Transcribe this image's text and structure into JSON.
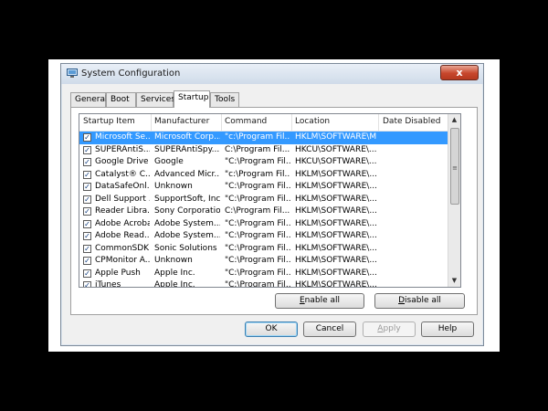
{
  "window": {
    "title": "System Configuration",
    "close_symbol": "x",
    "icon": "system-config-icon"
  },
  "tabs": [
    {
      "label": "General",
      "active": false
    },
    {
      "label": "Boot",
      "active": false
    },
    {
      "label": "Services",
      "active": false
    },
    {
      "label": "Startup",
      "active": true
    },
    {
      "label": "Tools",
      "active": false
    }
  ],
  "columns": [
    "Startup Item",
    "Manufacturer",
    "Command",
    "Location",
    "Date Disabled"
  ],
  "rows": [
    {
      "item": "Microsoft Se...",
      "manufacturer": "Microsoft Corp...",
      "command": "\"c:\\Program Fil...",
      "location": "HKLM\\SOFTWARE\\M...",
      "date": "",
      "checked": true,
      "selected": true
    },
    {
      "item": "SUPERAntiS...",
      "manufacturer": "SUPERAntiSpy...",
      "command": "C:\\Program Fil...",
      "location": "HKCU\\SOFTWARE\\...",
      "date": "",
      "checked": true,
      "selected": false
    },
    {
      "item": "Google Drive",
      "manufacturer": "Google",
      "command": "\"C:\\Program Fil...",
      "location": "HKCU\\SOFTWARE\\...",
      "date": "",
      "checked": true,
      "selected": false
    },
    {
      "item": "Catalyst® C...",
      "manufacturer": "Advanced Micr...",
      "command": "\"c:\\Program Fil...",
      "location": "HKLM\\SOFTWARE\\...",
      "date": "",
      "checked": true,
      "selected": false
    },
    {
      "item": "DataSafeOnl...",
      "manufacturer": "Unknown",
      "command": "\"C:\\Program Fil...",
      "location": "HKLM\\SOFTWARE\\...",
      "date": "",
      "checked": true,
      "selected": false
    },
    {
      "item": "Dell Support ...",
      "manufacturer": "SupportSoft, Inc.",
      "command": "\"C:\\Program Fil...",
      "location": "HKLM\\SOFTWARE\\...",
      "date": "",
      "checked": true,
      "selected": false
    },
    {
      "item": "Reader Libra...",
      "manufacturer": "Sony Corporation",
      "command": "C:\\Program Fil...",
      "location": "HKLM\\SOFTWARE\\...",
      "date": "",
      "checked": true,
      "selected": false
    },
    {
      "item": "Adobe Acrobat",
      "manufacturer": "Adobe System...",
      "command": "\"C:\\Program Fil...",
      "location": "HKLM\\SOFTWARE\\...",
      "date": "",
      "checked": true,
      "selected": false
    },
    {
      "item": "Adobe Read...",
      "manufacturer": "Adobe System...",
      "command": "\"C:\\Program Fil...",
      "location": "HKLM\\SOFTWARE\\...",
      "date": "",
      "checked": true,
      "selected": false
    },
    {
      "item": "CommonSDK",
      "manufacturer": "Sonic Solutions",
      "command": "\"C:\\Program Fil...",
      "location": "HKLM\\SOFTWARE\\...",
      "date": "",
      "checked": true,
      "selected": false
    },
    {
      "item": "CPMonitor A...",
      "manufacturer": "Unknown",
      "command": "\"C:\\Program Fil...",
      "location": "HKLM\\SOFTWARE\\...",
      "date": "",
      "checked": true,
      "selected": false
    },
    {
      "item": "Apple Push",
      "manufacturer": "Apple Inc.",
      "command": "\"C:\\Program Fil...",
      "location": "HKLM\\SOFTWARE\\...",
      "date": "",
      "checked": true,
      "selected": false
    },
    {
      "item": "iTunes",
      "manufacturer": "Apple Inc.",
      "command": "\"C:\\Program Fil...",
      "location": "HKLM\\SOFTWARE\\...",
      "date": "",
      "checked": true,
      "selected": false
    }
  ],
  "check_symbol": "✓",
  "scroll": {
    "up": "▲",
    "down": "▼",
    "grip": "≡"
  },
  "buttons": {
    "enable_all": {
      "access": "E",
      "rest": "nable all"
    },
    "disable_all": {
      "access": "D",
      "rest": "isable all"
    },
    "ok": "OK",
    "cancel": "Cancel",
    "apply": {
      "access": "A",
      "rest": "pply"
    },
    "help": "Help"
  },
  "colors": {
    "selection": "#3399ff",
    "close_button": "#c7462c"
  }
}
